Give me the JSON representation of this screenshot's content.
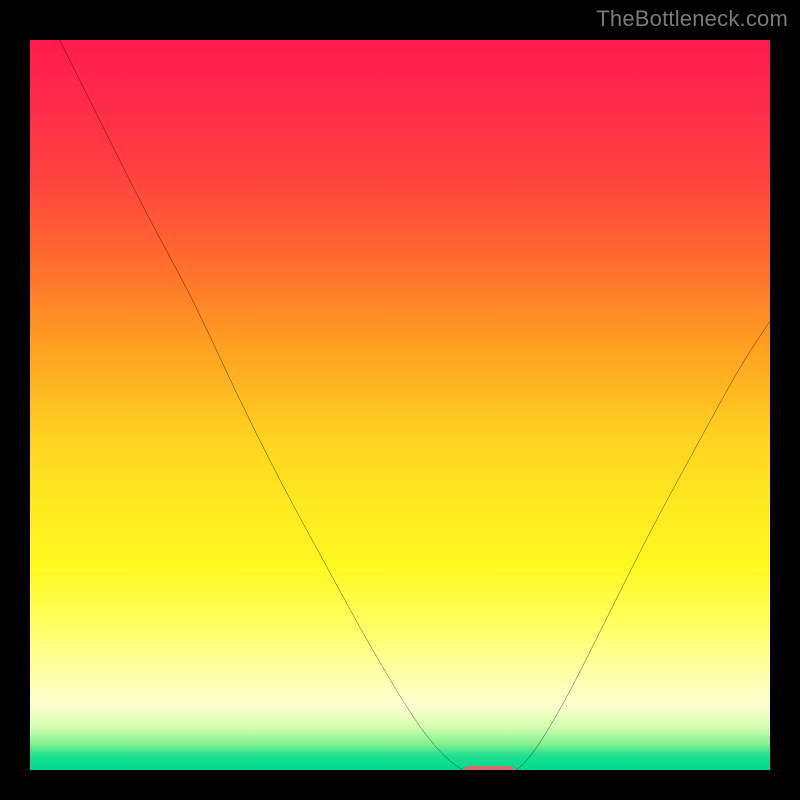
{
  "watermark": "TheBottleneck.com",
  "chart_data": {
    "type": "line",
    "title": "",
    "xlabel": "",
    "ylabel": "",
    "xlim": [
      0,
      100
    ],
    "ylim": [
      0,
      100
    ],
    "grid": false,
    "curve_xy": [
      [
        4,
        100
      ],
      [
        10,
        88
      ],
      [
        16,
        76
      ],
      [
        22,
        65
      ],
      [
        28,
        52
      ],
      [
        34,
        40
      ],
      [
        40,
        29
      ],
      [
        46,
        18
      ],
      [
        52,
        8
      ],
      [
        56,
        3
      ],
      [
        59,
        1
      ],
      [
        61,
        0.5
      ],
      [
        64,
        0.5
      ],
      [
        67,
        2
      ],
      [
        72,
        10
      ],
      [
        78,
        22
      ],
      [
        84,
        34
      ],
      [
        90,
        45
      ],
      [
        96,
        56
      ],
      [
        100,
        62
      ]
    ],
    "marker": {
      "x_center": 62,
      "y": 0.3,
      "width": 7,
      "height": 1.6,
      "color": "#d96a6a"
    },
    "background": "rainbow-vertical-gradient",
    "curve_color": "#000000"
  }
}
